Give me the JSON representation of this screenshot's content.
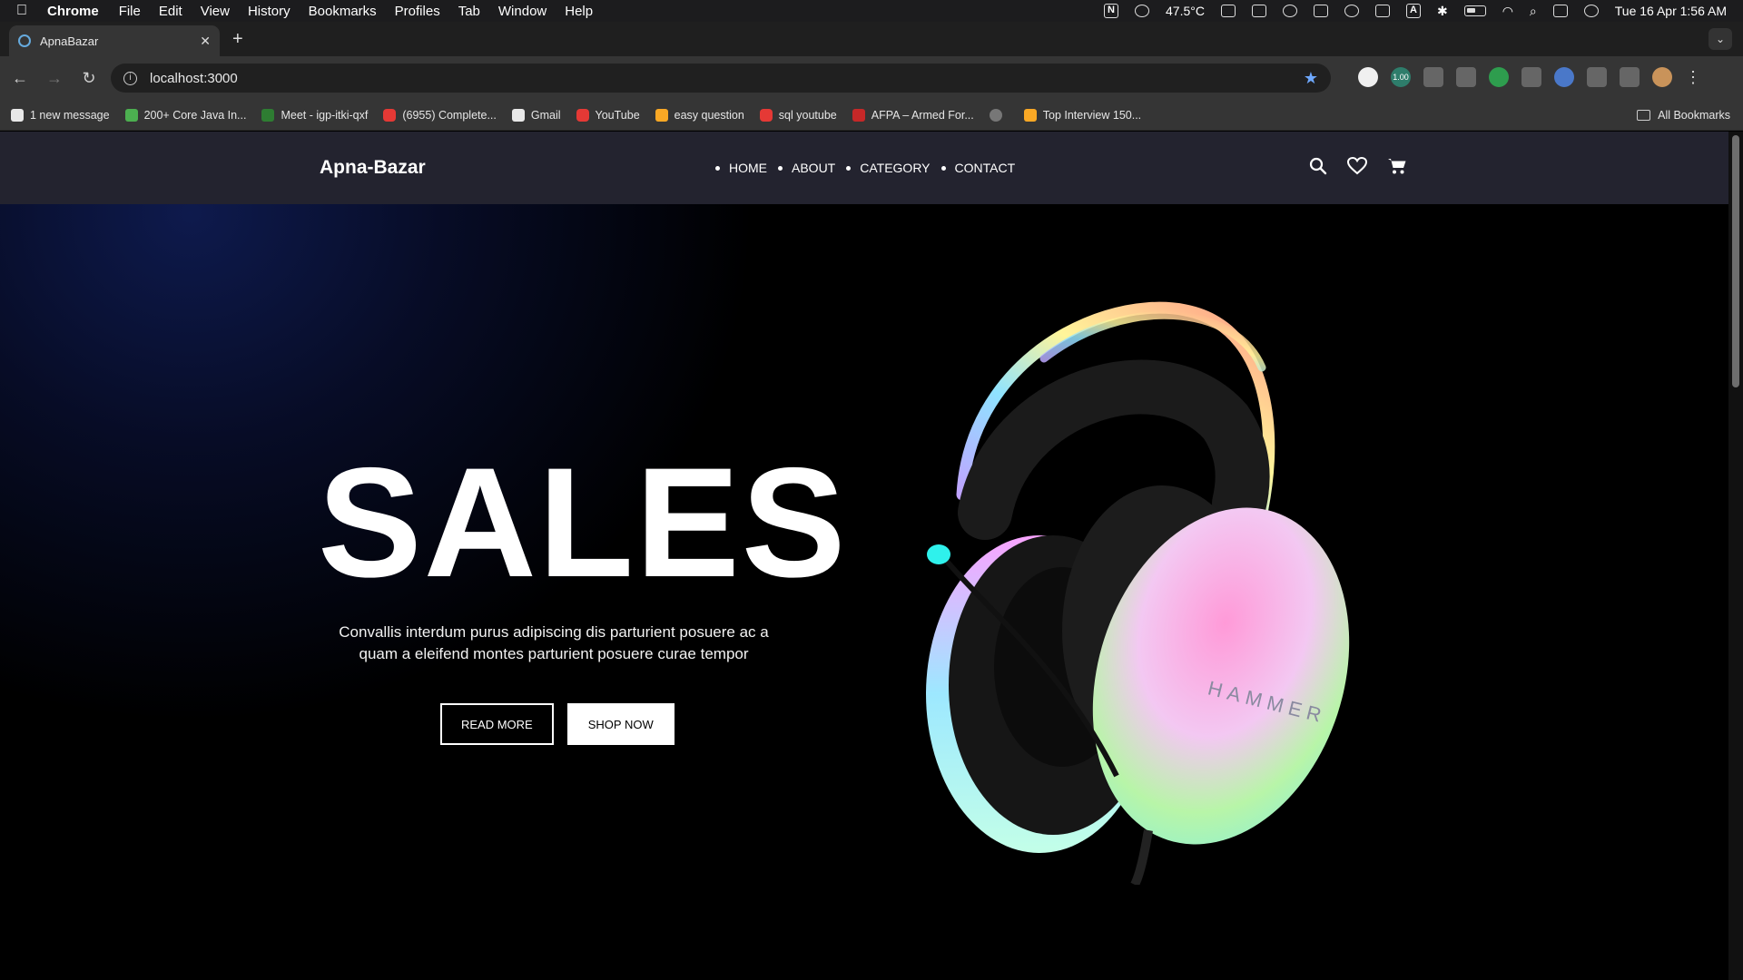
{
  "os_menubar": {
    "app": "Chrome",
    "items": [
      "File",
      "Edit",
      "View",
      "History",
      "Bookmarks",
      "Profiles",
      "Tab",
      "Window",
      "Help"
    ],
    "temperature": "47.5°C",
    "datetime": "Tue 16 Apr  1:56 AM"
  },
  "browser": {
    "tab_title": "ApnaBazar",
    "url": "localhost:3000",
    "extension_badge": "1.00",
    "bookmarks": [
      {
        "label": "1 new message",
        "icon": "gm"
      },
      {
        "label": "200+ Core Java In...",
        "icon": "grn"
      },
      {
        "label": "Meet - igp-itki-qxf",
        "icon": "mt"
      },
      {
        "label": "(6955) Complete...",
        "icon": "yt"
      },
      {
        "label": "Gmail",
        "icon": "gm"
      },
      {
        "label": "YouTube",
        "icon": "yt"
      },
      {
        "label": "easy question",
        "icon": "lc"
      },
      {
        "label": "sql youtube",
        "icon": "yt"
      },
      {
        "label": "AFPA – Armed For...",
        "icon": "af"
      },
      {
        "label": "",
        "icon": "gl"
      },
      {
        "label": "Top Interview 150...",
        "icon": "lc"
      }
    ],
    "all_bookmarks": "All Bookmarks"
  },
  "site": {
    "brand": "Apna-Bazar",
    "nav": [
      "HOME",
      "ABOUT",
      "CATEGORY",
      "CONTACT"
    ],
    "hero": {
      "title": "SALES",
      "text": "Convallis interdum purus adipiscing dis parturient posuere ac a quam a eleifend montes parturient posuere curae tempor",
      "read_more": "READ MORE",
      "shop_now": "SHOP NOW",
      "product_brand": "HAMMER"
    }
  }
}
